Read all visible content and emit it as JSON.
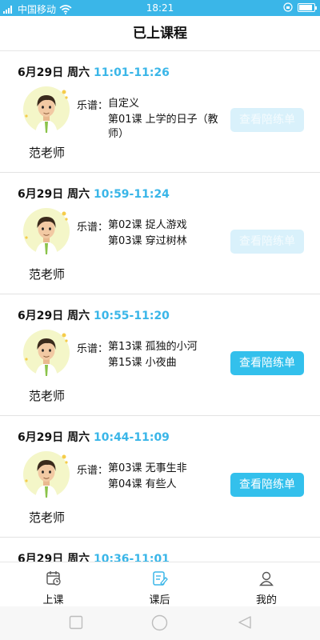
{
  "status_bar": {
    "carrier": "中国移动",
    "time": "18:21"
  },
  "header": {
    "title": "已上课程"
  },
  "courses": [
    {
      "date": "6月29日 周六",
      "time": "11:01-11:26",
      "teacher": "范老师",
      "score_label": "乐谱：",
      "lessons": [
        "自定义",
        "第01课 上学的日子（教师）"
      ],
      "button_label": "查看陪练单",
      "button_enabled": false
    },
    {
      "date": "6月29日 周六",
      "time": "10:59-11:24",
      "teacher": "范老师",
      "score_label": "乐谱：",
      "lessons": [
        "第02课 捉人游戏",
        "第03课 穿过树林"
      ],
      "button_label": "查看陪练单",
      "button_enabled": false
    },
    {
      "date": "6月29日 周六",
      "time": "10:55-11:20",
      "teacher": "范老师",
      "score_label": "乐谱：",
      "lessons": [
        "第13课 孤独的小河",
        "第15课 小夜曲"
      ],
      "button_label": "查看陪练单",
      "button_enabled": true
    },
    {
      "date": "6月29日 周六",
      "time": "10:44-11:09",
      "teacher": "范老师",
      "score_label": "乐谱：",
      "lessons": [
        "第03课 无事生非",
        "第04课 有些人"
      ],
      "button_label": "查看陪练单",
      "button_enabled": true
    },
    {
      "date": "6月29日 周六",
      "time": "10:36-11:01",
      "teacher": "",
      "score_label": "",
      "lessons": [],
      "button_label": "",
      "button_enabled": true
    }
  ],
  "tabs": [
    {
      "label": "上课",
      "icon": "calendar-clock-icon",
      "active": false
    },
    {
      "label": "课后",
      "icon": "edit-note-icon",
      "active": true
    },
    {
      "label": "我的",
      "icon": "user-icon",
      "active": false
    }
  ],
  "colors": {
    "accent": "#3ab6e8",
    "button": "#33c0ec",
    "button_disabled": "#d9f1fb"
  }
}
